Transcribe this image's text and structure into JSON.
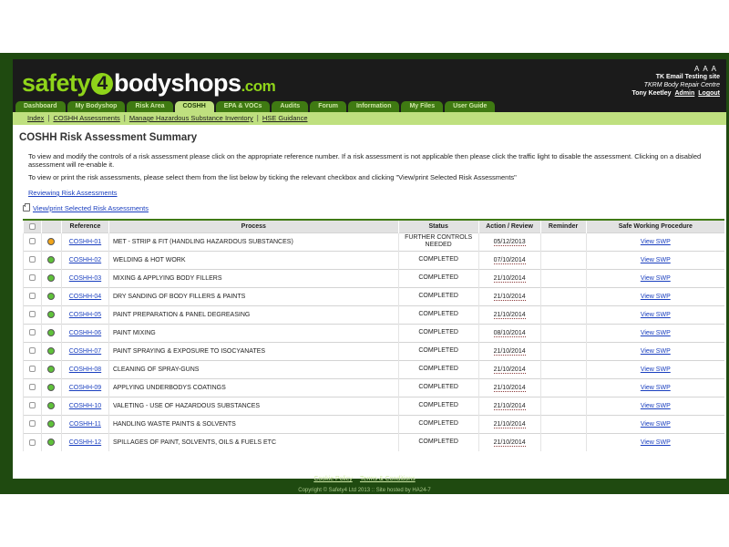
{
  "header": {
    "logo": {
      "part1": "safety",
      "four": "4",
      "part2": "bodyshops",
      "part3": ".com"
    },
    "font_sizes": [
      "A",
      "A",
      "A"
    ],
    "site_name": "TK Email Testing site",
    "company": "TKRM Body Repair Centre",
    "user_name": "Tony Keetley",
    "admin_link": "Admin",
    "logout_link": "Logout"
  },
  "nav": {
    "tabs": [
      {
        "label": "Dashboard",
        "active": false
      },
      {
        "label": "My Bodyshop",
        "active": false
      },
      {
        "label": "Risk Area",
        "active": false
      },
      {
        "label": "COSHH",
        "active": true
      },
      {
        "label": "EPA & VOCs",
        "active": false
      },
      {
        "label": "Audits",
        "active": false
      },
      {
        "label": "Forum",
        "active": false
      },
      {
        "label": "Information",
        "active": false
      },
      {
        "label": "My Files",
        "active": false
      },
      {
        "label": "User Guide",
        "active": false
      }
    ],
    "sub": [
      "Index",
      "COSHH Assessments",
      "Manage Hazardous Substance Inventory",
      "HSE Guidance"
    ],
    "sub_separator": "|"
  },
  "main": {
    "title": "COSHH Risk Assessment Summary",
    "intro1": "To view and modify the controls of a risk assessment please click on the appropriate reference number. If a risk assessment is not applicable then please click the traffic light to disable the assessment. Clicking on a disabled assessment will re-enable it.",
    "intro2": "To view or print the risk assessments, please select them from the list below by ticking the relevant checkbox and clicking \"View/print Selected Risk Assessments\"",
    "reviewing_link": "Reviewing Risk Assessments",
    "print_link": "View/print Selected Risk Assessments"
  },
  "table": {
    "headers": [
      "",
      "",
      "Reference",
      "Process",
      "Status",
      "Action / Review",
      "Reminder",
      "Safe Working Procedure"
    ],
    "rows": [
      {
        "ref": "COSHH-01",
        "process": "MET - STRIP & FIT (HANDLING HAZARDOUS SUBSTANCES)",
        "status": "FURTHER CONTROLS NEEDED",
        "date": "05/12/2013",
        "reminder": "",
        "swp": "View SWP",
        "light": "#f2a51a"
      },
      {
        "ref": "COSHH-02",
        "process": "WELDING & HOT WORK",
        "status": "COMPLETED",
        "date": "07/10/2014",
        "reminder": "",
        "swp": "View SWP",
        "light": "#5fc23a"
      },
      {
        "ref": "COSHH-03",
        "process": "MIXING & APPLYING BODY FILLERS",
        "status": "COMPLETED",
        "date": "21/10/2014",
        "reminder": "",
        "swp": "View SWP",
        "light": "#5fc23a"
      },
      {
        "ref": "COSHH-04",
        "process": "DRY SANDING OF BODY FILLERS & PAINTS",
        "status": "COMPLETED",
        "date": "21/10/2014",
        "reminder": "",
        "swp": "View SWP",
        "light": "#5fc23a"
      },
      {
        "ref": "COSHH-05",
        "process": "PAINT PREPARATION & PANEL DEGREASING",
        "status": "COMPLETED",
        "date": "21/10/2014",
        "reminder": "",
        "swp": "View SWP",
        "light": "#5fc23a"
      },
      {
        "ref": "COSHH-06",
        "process": "PAINT MIXING",
        "status": "COMPLETED",
        "date": "08/10/2014",
        "reminder": "",
        "swp": "View SWP",
        "light": "#5fc23a"
      },
      {
        "ref": "COSHH-07",
        "process": "PAINT SPRAYING & EXPOSURE TO ISOCYANATES",
        "status": "COMPLETED",
        "date": "21/10/2014",
        "reminder": "",
        "swp": "View SWP",
        "light": "#5fc23a"
      },
      {
        "ref": "COSHH-08",
        "process": "CLEANING OF SPRAY-GUNS",
        "status": "COMPLETED",
        "date": "21/10/2014",
        "reminder": "",
        "swp": "View SWP",
        "light": "#5fc23a"
      },
      {
        "ref": "COSHH-09",
        "process": "APPLYING UNDERBODYS COATINGS",
        "status": "COMPLETED",
        "date": "21/10/2014",
        "reminder": "",
        "swp": "View SWP",
        "light": "#5fc23a"
      },
      {
        "ref": "COSHH-10",
        "process": "VALETING - USE OF HAZARDOUS SUBSTANCES",
        "status": "COMPLETED",
        "date": "21/10/2014",
        "reminder": "",
        "swp": "View SWP",
        "light": "#5fc23a"
      },
      {
        "ref": "COSHH-11",
        "process": "HANDLING WASTE PAINTS & SOLVENTS",
        "status": "COMPLETED",
        "date": "21/10/2014",
        "reminder": "",
        "swp": "View SWP",
        "light": "#5fc23a"
      },
      {
        "ref": "COSHH-12",
        "process": "SPILLAGES OF PAINT, SOLVENTS, OILS & FUELS ETC",
        "status": "COMPLETED",
        "date": "21/10/2014",
        "reminder": "",
        "swp": "View SWP",
        "light": "#5fc23a"
      }
    ]
  },
  "footer": {
    "links": [
      "Cookie Policy",
      "Terms & Conditions"
    ],
    "copyright": "Copyright © Safety4 Ltd 2013 :: Site hosted by HA24-7"
  }
}
